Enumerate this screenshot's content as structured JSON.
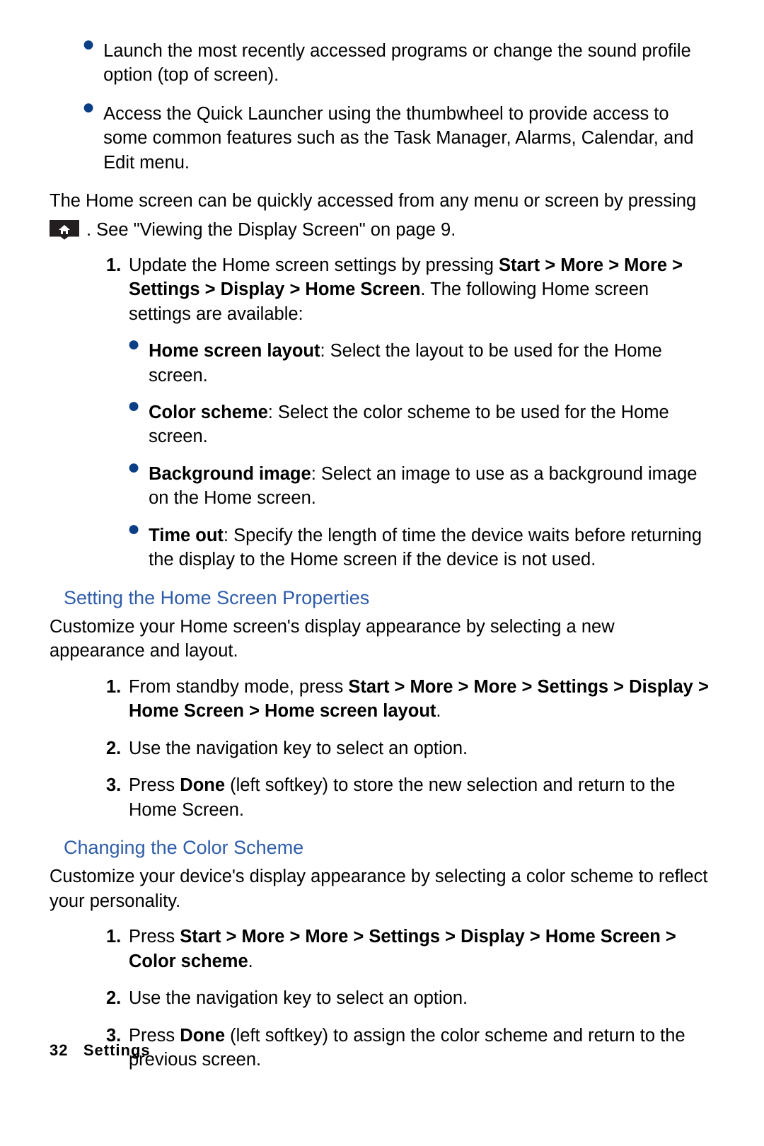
{
  "intro": {
    "bullets": [
      "Launch the most recently accessed programs or change the sound profile option (top of screen).",
      "Access the Quick Launcher using the thumbwheel to provide access to some common features such as the Task Manager, Alarms, Calendar, and Edit menu."
    ],
    "para1": "The Home screen can be quickly accessed from any menu or screen by pressing",
    "para2": ". See \"Viewing the Display Screen\" on page 9."
  },
  "ol1": {
    "n1": "1.",
    "t1a": "Update the Home screen settings by pressing ",
    "t1b": "Start > More > More > Settings > Display > Home Screen",
    "t1c": ". The following Home screen settings are available:",
    "sub": [
      {
        "term": "Home screen layout",
        "text": ": Select the layout to be used for the Home screen."
      },
      {
        "term": "Color scheme",
        "text": ": Select the color scheme to be used for the Home screen."
      },
      {
        "term": "Background image",
        "text": ": Select an image to use as a background image on the Home screen."
      },
      {
        "term": "Time out",
        "text": ": Specify the length of time the device waits before returning the display to the Home screen if the device is not used."
      }
    ]
  },
  "section2": {
    "heading": "Setting the Home Screen Properties",
    "para": "Customize your Home screen's display appearance by selecting a new appearance and layout.",
    "ol": {
      "n1": "1.",
      "t1a": "From standby mode, press ",
      "t1b": "Start > More > More > Settings > Display > Home Screen > Home screen layout",
      "t1c": ".",
      "n2": "2.",
      "t2": "Use the navigation key to select an option.",
      "n3": "3.",
      "t3a": "Press ",
      "t3b": "Done",
      "t3c": " (left softkey) to store the new selection and return to the Home Screen."
    }
  },
  "section3": {
    "heading": "Changing the Color Scheme",
    "para": "Customize your device's display appearance by selecting a color scheme to reflect your personality.",
    "ol": {
      "n1": "1.",
      "t1a": "Press ",
      "t1b": "Start > More > More > Settings > Display > Home Screen > Color scheme",
      "t1c": ".",
      "n2": "2.",
      "t2": "Use the navigation key to select an option.",
      "n3": "3.",
      "t3a": "Press ",
      "t3b": "Done",
      "t3c": " (left softkey) to assign the color scheme and return to the previous screen."
    }
  },
  "footer": {
    "pagenum": "32",
    "section": "Settings"
  }
}
